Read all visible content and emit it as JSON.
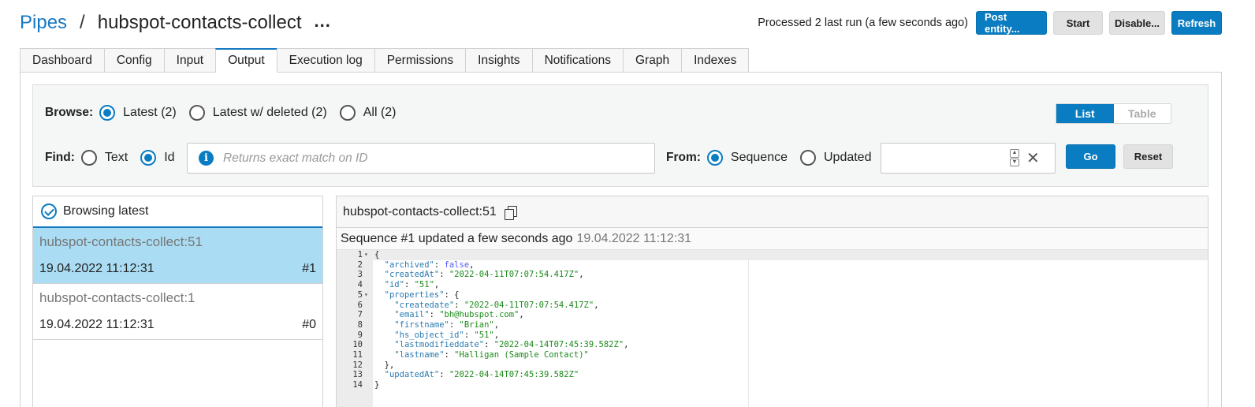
{
  "header": {
    "breadcrumb_link": "Pipes",
    "separator": "/",
    "title": "hubspot-contacts-collect",
    "more": "...",
    "status": "Processed 2 last run (a few seconds ago)",
    "buttons": {
      "post_entity": "Post entity...",
      "start": "Start",
      "disable": "Disable...",
      "refresh": "Refresh"
    }
  },
  "tabs": [
    "Dashboard",
    "Config",
    "Input",
    "Output",
    "Execution log",
    "Permissions",
    "Insights",
    "Notifications",
    "Graph",
    "Indexes"
  ],
  "active_tab": "Output",
  "browse": {
    "label": "Browse:",
    "options": [
      "Latest (2)",
      "Latest w/ deleted (2)",
      "All (2)"
    ],
    "selected": "Latest (2)",
    "view_toggle": [
      "List",
      "Table"
    ],
    "view_selected": "List"
  },
  "find": {
    "label": "Find:",
    "options": [
      "Text",
      "Id"
    ],
    "selected": "Id",
    "placeholder": "Returns exact match on ID",
    "info_icon_glyph": "i"
  },
  "from": {
    "label": "From:",
    "options": [
      "Sequence",
      "Updated"
    ],
    "selected": "Sequence",
    "value": "",
    "clear_glyph": "✕",
    "go": "Go",
    "reset": "Reset"
  },
  "list": {
    "header": "Browsing latest",
    "items": [
      {
        "name": "hubspot-contacts-collect:51",
        "date": "19.04.2022 11:12:31",
        "seq": "#1",
        "selected": true
      },
      {
        "name": "hubspot-contacts-collect:1",
        "date": "19.04.2022 11:12:31",
        "seq": "#0",
        "selected": false
      }
    ]
  },
  "detail": {
    "title": "hubspot-contacts-collect:51",
    "seq_text": "Sequence #1 updated a few seconds ago",
    "seq_timestamp": "19.04.2022 11:12:31",
    "code_lines": [
      "{",
      "  \"archived\": false,",
      "  \"createdAt\": \"2022-04-11T07:07:54.417Z\",",
      "  \"id\": \"51\",",
      "  \"properties\": {",
      "    \"createdate\": \"2022-04-11T07:07:54.417Z\",",
      "    \"email\": \"bh@hubspot.com\",",
      "    \"firstname\": \"Brian\",",
      "    \"hs_object_id\": \"51\",",
      "    \"lastmodifieddate\": \"2022-04-14T07:45:39.582Z\",",
      "    \"lastname\": \"Halligan (Sample Contact)\"",
      "  },",
      "  \"updatedAt\": \"2022-04-14T07:45:39.582Z\"",
      "}"
    ],
    "fold_lines": [
      1,
      5
    ]
  },
  "colors": {
    "accent": "#0a7cc1",
    "link": "#1678c2",
    "selected_row": "#aadcf3",
    "json_key": "#2a7ab0",
    "json_string": "#1a8a1a",
    "json_bool": "#585cf6"
  }
}
